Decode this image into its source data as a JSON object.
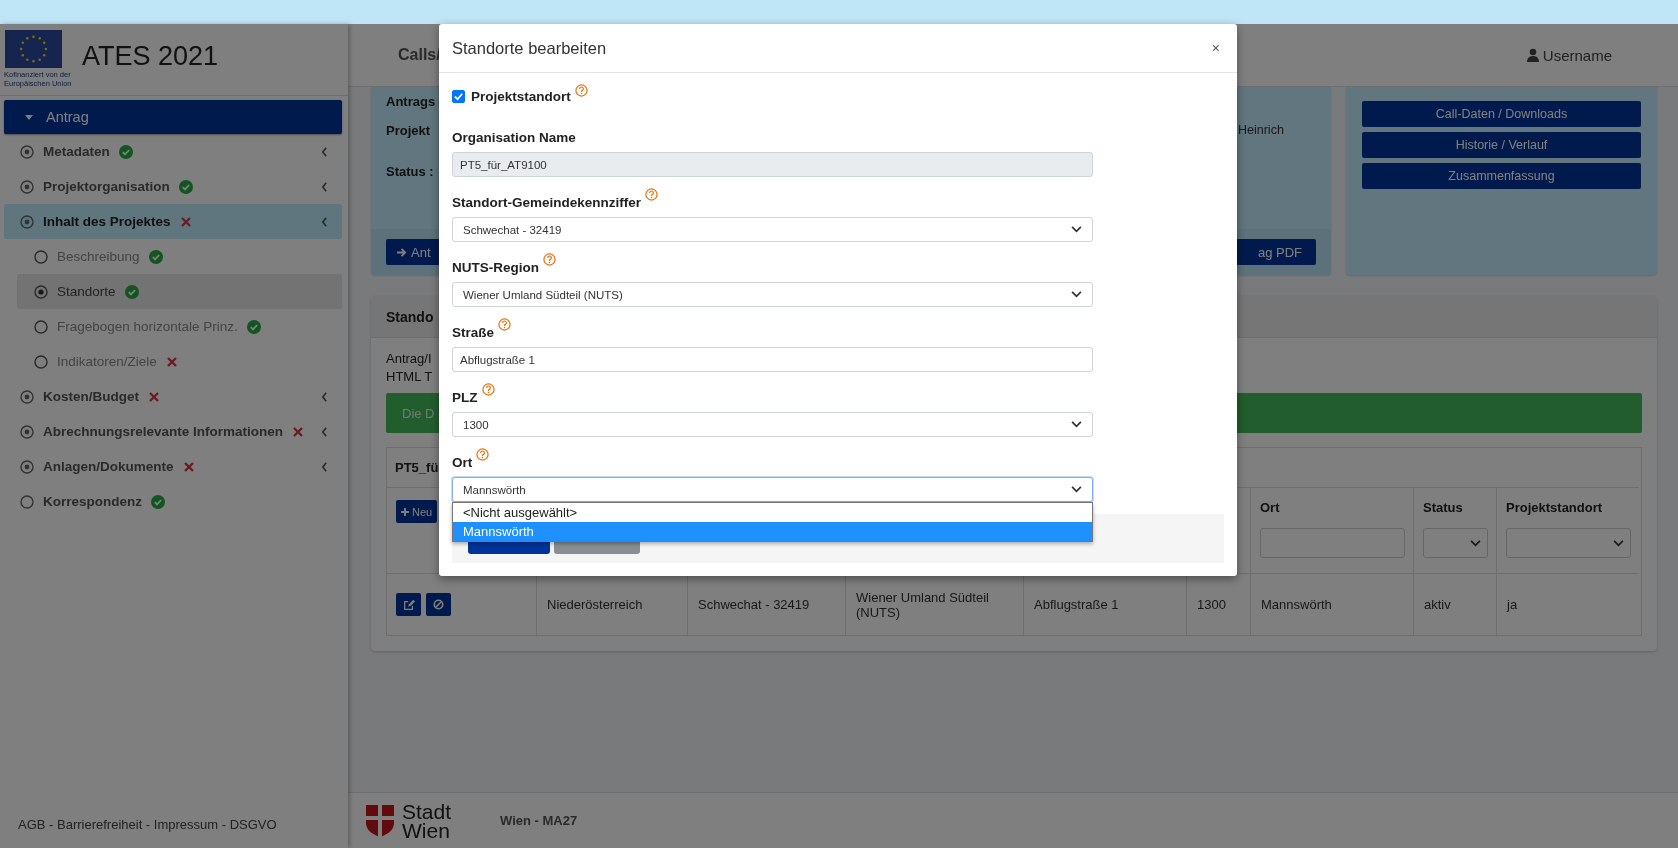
{
  "sidebar": {
    "logo_caption": "Kofinanziert von der Europäischen Union",
    "app_title": "ATES 2021",
    "nav": [
      {
        "label": "Antrag",
        "expanded": true,
        "children": [
          {
            "label": "Metadaten",
            "complete": true,
            "expandable": true,
            "expanded": false
          },
          {
            "label": "Projektorganisation",
            "complete": true,
            "expandable": true,
            "expanded": false
          },
          {
            "label": "Inhalt des Projektes",
            "complete": false,
            "expandable": true,
            "expanded": true,
            "children": [
              {
                "label": "Beschreibung",
                "complete": true,
                "selected": false
              },
              {
                "label": "Standorte",
                "complete": true,
                "selected": true
              },
              {
                "label": "Fragebogen horizontale Prinz.",
                "complete": true,
                "selected": false
              },
              {
                "label": "Indikatoren/Ziele",
                "complete": false,
                "selected": false
              }
            ]
          },
          {
            "label": "Kosten/Budget",
            "complete": false,
            "expandable": true,
            "expanded": false
          },
          {
            "label": "Abrechnungsrelevante Informationen",
            "complete": false,
            "expandable": true,
            "expanded": false
          },
          {
            "label": "Anlagen/Dokumente",
            "complete": false,
            "expandable": true,
            "expanded": false
          },
          {
            "label": "Korrespondenz",
            "complete": true,
            "expandable": false,
            "expanded": false
          }
        ]
      }
    ],
    "footer": "AGB - Barrierefreiheit - Impressum - DSGVO"
  },
  "header": {
    "nav_text": "Calls/",
    "username": "Username"
  },
  "summary_card": {
    "lines": [
      "Antrags",
      "Projekt",
      "Status :"
    ],
    "right_text": "Heinrich",
    "buttons": [
      "Ant",
      "ag PDF"
    ]
  },
  "actions_card": {
    "buttons": [
      "Call-Daten / Downloads",
      "Historie / Verlauf",
      "Zusammenfassung"
    ]
  },
  "locations_card": {
    "title": "Stando",
    "text_lines": [
      "Antrag/I",
      "HTML T"
    ],
    "alert": "Die D",
    "table": {
      "title": "PT5_fü",
      "new_button": "Neu",
      "columns": [
        {
          "kind": "actions"
        },
        {
          "kind": "blank"
        },
        {
          "kind": "blank"
        },
        {
          "kind": "blank"
        },
        {
          "kind": "blank"
        },
        {
          "kind": "blank"
        },
        {
          "kind": "text_filter",
          "label": "Ort"
        },
        {
          "kind": "select_filter",
          "label": "Status"
        },
        {
          "kind": "select_filter",
          "label": "Projektstandort"
        }
      ],
      "rows": [
        {
          "cells": [
            "",
            "Niederösterreich",
            "Schwechat - 32419",
            "Wiener Umland Südteil (NUTS)",
            "Abflugstraße 1",
            "1300",
            "Mannswörth",
            "aktiv",
            "ja"
          ]
        }
      ]
    }
  },
  "footer": {
    "logo_text": "Stadt Wien",
    "org": "Wien - MA27"
  },
  "modal": {
    "title": "Standorte bearbeiten",
    "close": "×",
    "fields": [
      {
        "kind": "checkbox",
        "label": "Projektstandort",
        "checked": true,
        "help": true
      },
      {
        "kind": "readonly",
        "label": "Organisation Name",
        "value": "PT5_für_AT9100",
        "help": false
      },
      {
        "kind": "select",
        "label": "Standort-Gemeindekennziffer",
        "value": "Schwechat - 32419",
        "help": true,
        "focused": false
      },
      {
        "kind": "select",
        "label": "NUTS-Region",
        "value": "Wiener Umland Südteil (NUTS)",
        "help": true,
        "focused": false
      },
      {
        "kind": "text",
        "label": "Straße",
        "value": "Abflugstraße 1",
        "help": true
      },
      {
        "kind": "select",
        "label": "PLZ",
        "value": "1300",
        "help": true,
        "focused": false
      },
      {
        "kind": "select",
        "label": "Ort",
        "value": "Mannswörth",
        "help": true,
        "focused": true,
        "options": [
          {
            "label": "<Nicht ausgewählt>",
            "selected": false
          },
          {
            "label": "Mannswörth",
            "selected": true
          }
        ]
      }
    ],
    "footer_buttons": [
      {
        "kind": "primary"
      },
      {
        "kind": "secondary"
      }
    ]
  }
}
